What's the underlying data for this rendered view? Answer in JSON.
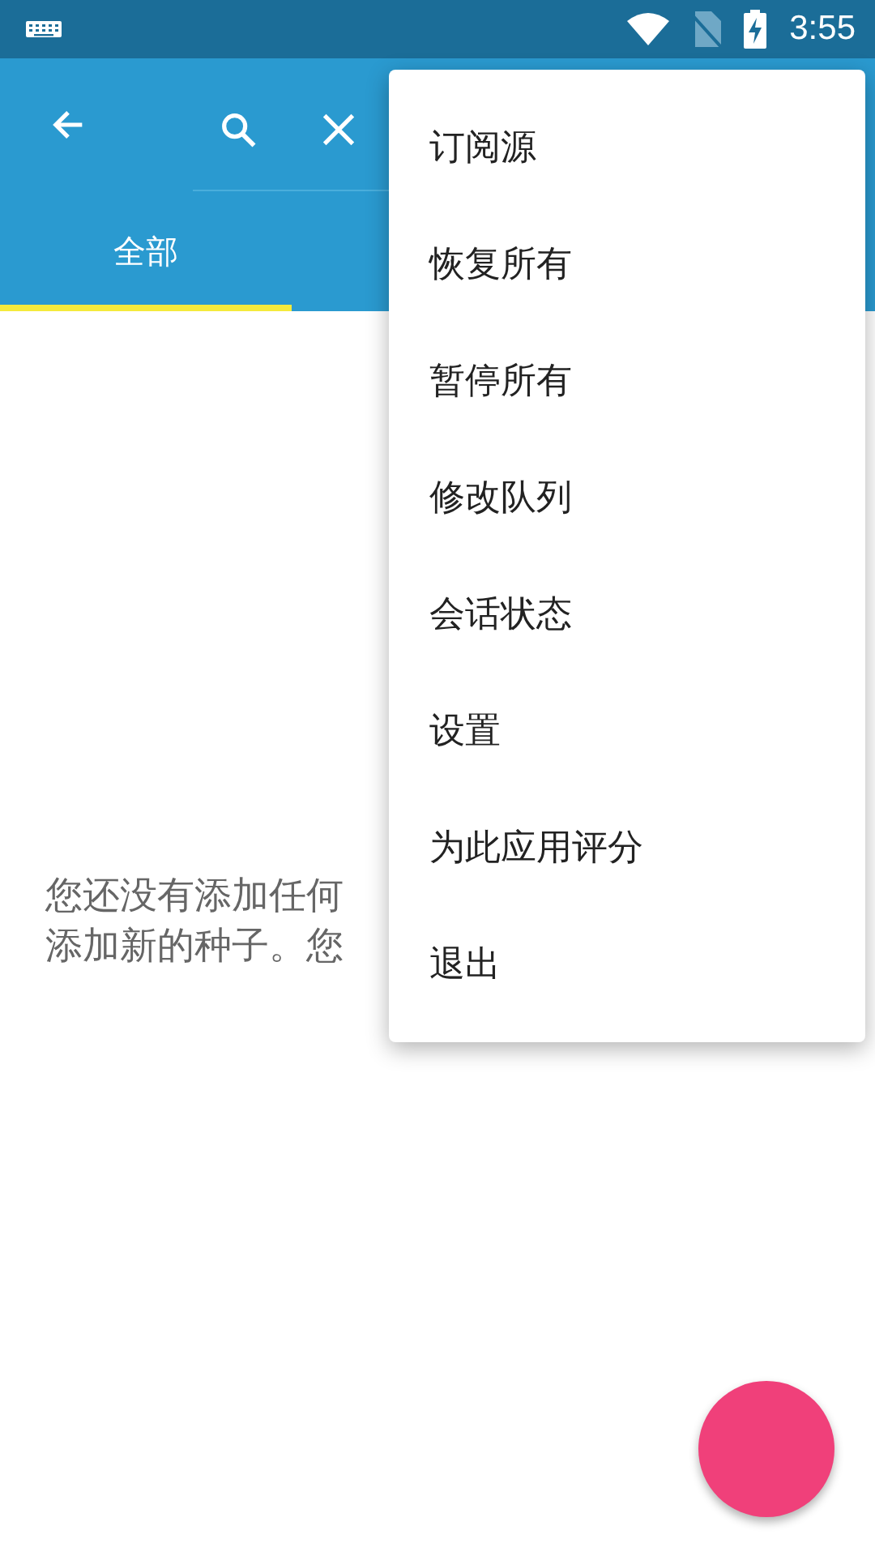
{
  "status_bar": {
    "time": "3:55"
  },
  "tabs": [
    {
      "label": "全部",
      "selected": true
    }
  ],
  "empty_message": {
    "lines": [
      "您还没有添加任何",
      "添加新的种子。您"
    ]
  },
  "menu": {
    "items": [
      {
        "label": "订阅源"
      },
      {
        "label": "恢复所有"
      },
      {
        "label": "暂停所有"
      },
      {
        "label": "修改队列"
      },
      {
        "label": "会话状态"
      },
      {
        "label": "设置"
      },
      {
        "label": "为此应用评分"
      },
      {
        "label": "退出"
      }
    ]
  }
}
